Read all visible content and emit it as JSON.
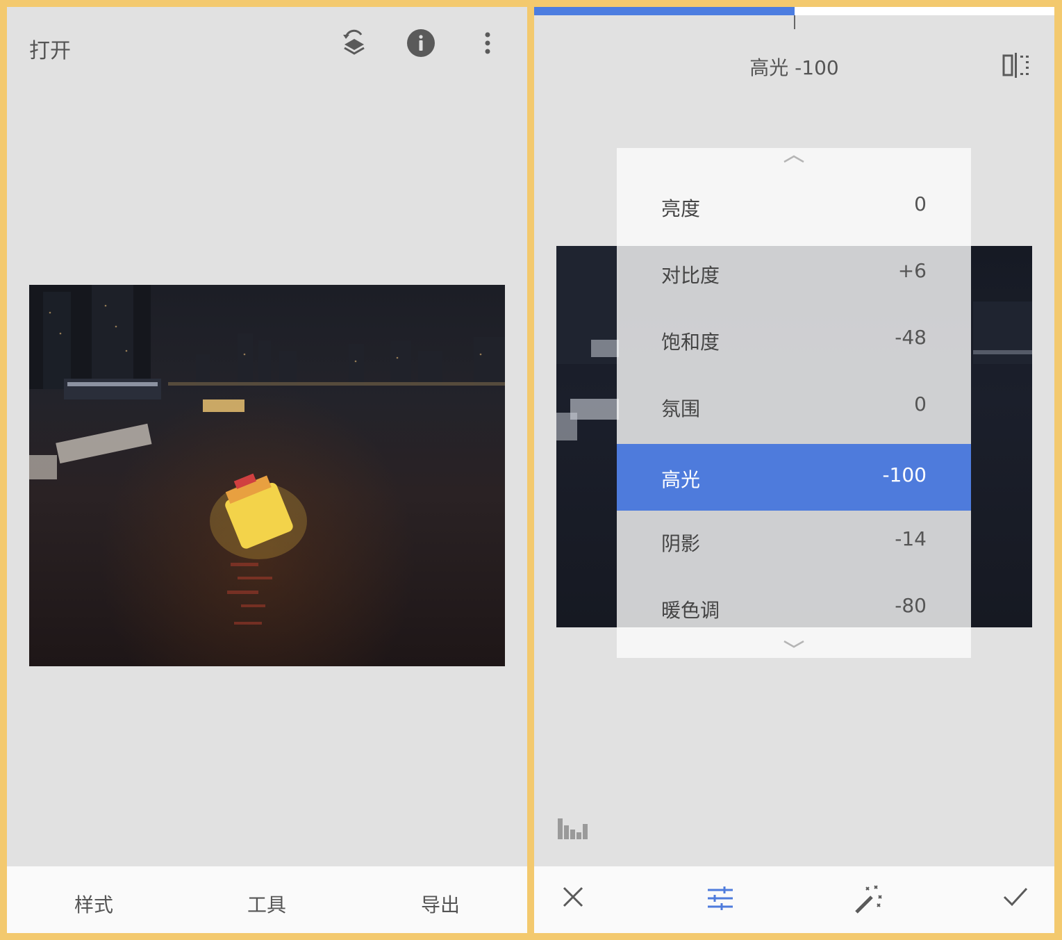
{
  "left_screen": {
    "header": {
      "open_label": "打开",
      "icons": [
        "layers-undo-icon",
        "info-icon",
        "more-vert-icon"
      ]
    },
    "bottom_tabs": [
      {
        "label": "样式"
      },
      {
        "label": "工具"
      },
      {
        "label": "导出"
      }
    ]
  },
  "right_screen": {
    "progress_fraction": 0.5,
    "parameter_title": "高光 -100",
    "menu_items": [
      {
        "label": "亮度",
        "value": "0"
      },
      {
        "label": "对比度",
        "value": "+6"
      },
      {
        "label": "饱和度",
        "value": "-48"
      },
      {
        "label": "氛围",
        "value": "0"
      },
      {
        "label": "高光",
        "value": "-100",
        "selected": true
      },
      {
        "label": "阴影",
        "value": "-14"
      },
      {
        "label": "暖色调",
        "value": "-80"
      }
    ],
    "bottom_icons": [
      "close-icon",
      "tune-sliders-icon",
      "magic-wand-icon",
      "check-icon"
    ]
  },
  "colors": {
    "accent": "#4e7bdc",
    "frame": "#f3c96e",
    "panel_bg": "#e1e1e1"
  }
}
